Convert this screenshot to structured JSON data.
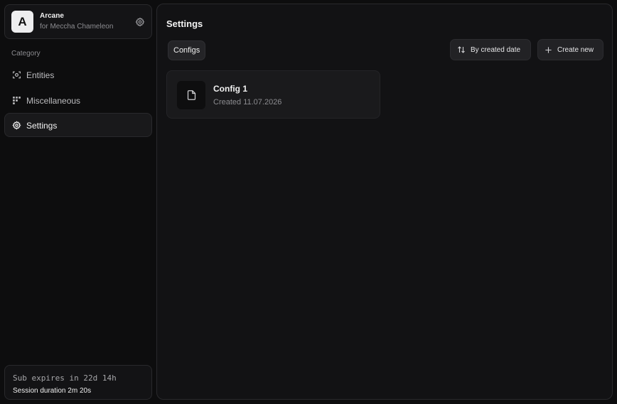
{
  "app": {
    "logo_letter": "A",
    "name": "Arcane",
    "subtitle": "for Meccha Chameleon"
  },
  "sidebar": {
    "category_label": "Category",
    "items": [
      {
        "label": "Entities",
        "icon": "scan-target-icon",
        "active": false
      },
      {
        "label": "Miscellaneous",
        "icon": "grid-dots-icon",
        "active": false
      },
      {
        "label": "Settings",
        "icon": "gear-icon",
        "active": true
      }
    ]
  },
  "subscription": {
    "expires_text": "Sub expires in 22d 14h",
    "session_text": "Session duration  2m 20s"
  },
  "main": {
    "title": "Settings",
    "tabs": [
      {
        "label": "Configs",
        "active": true
      }
    ],
    "sort_label": "By created date",
    "create_label": "Create new",
    "configs": [
      {
        "name": "Config 1",
        "created": "Created 11.07.2026",
        "icon": "file-icon"
      }
    ]
  },
  "colors": {
    "background": "#0d0d0e",
    "panel": "#121214",
    "border": "#29292c",
    "text": "#f2f2f2",
    "muted": "#8c8c90"
  }
}
